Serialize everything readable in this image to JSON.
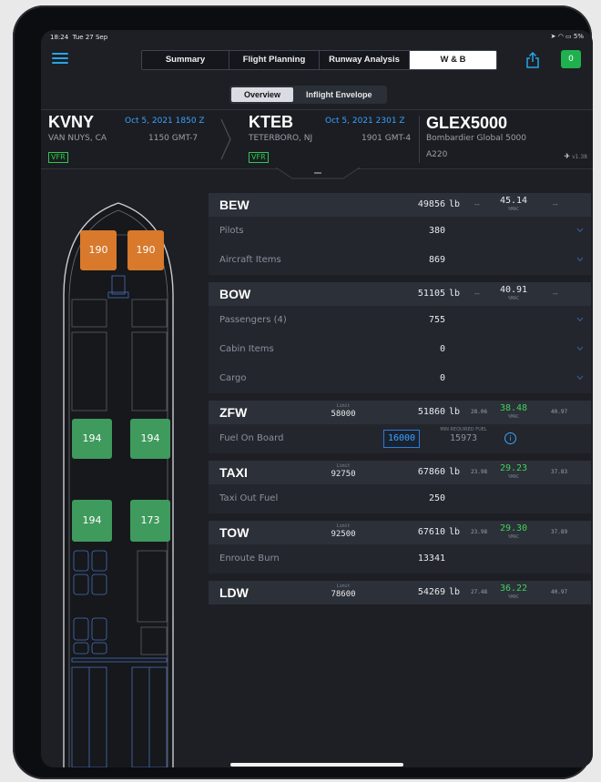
{
  "status": {
    "time": "18:24",
    "date": "Tue 27 Sep",
    "battery": "5%"
  },
  "nav": {
    "tabs": [
      {
        "label": "Summary"
      },
      {
        "label": "Flight Planning"
      },
      {
        "label": "Runway Analysis"
      },
      {
        "label": "W & B",
        "active": true
      }
    ],
    "badge": "0"
  },
  "subtabs": [
    {
      "label": "Overview",
      "active": true
    },
    {
      "label": "Inflight Envelope"
    }
  ],
  "route": {
    "from": {
      "code": "KVNY",
      "datetime": "Oct 5, 2021 1850 Z",
      "city": "VAN NUYS, CA",
      "local": "1150 GMT-7",
      "rules": "VFR"
    },
    "to": {
      "code": "KTEB",
      "datetime": "Oct 5, 2021 2301 Z",
      "city": "TETERBORO, NJ",
      "local": "1901 GMT-4",
      "rules": "VFR"
    },
    "aircraft": {
      "type": "GLEX5000",
      "name": "Bombardier Global 5000",
      "reg": "A220",
      "version": "v1.38"
    }
  },
  "seats": {
    "pilots": [
      "190",
      "190"
    ],
    "row1": [
      "194",
      "194"
    ],
    "row2": [
      "194",
      "173"
    ]
  },
  "wb": {
    "bew": {
      "label": "BEW",
      "value": "49856",
      "unit": "lb",
      "dash1": "--",
      "mac": "45.14",
      "mac_unit": "%MAC",
      "dash2": "--"
    },
    "pilots": {
      "label": "Pilots",
      "value": "380"
    },
    "aircraft_items": {
      "label": "Aircraft Items",
      "value": "869"
    },
    "bow": {
      "label": "BOW",
      "value": "51105",
      "unit": "lb",
      "dash1": "--",
      "mac": "40.91",
      "mac_unit": "%MAC",
      "dash2": "--"
    },
    "passengers": {
      "label": "Passengers (4)",
      "value": "755"
    },
    "cabin_items": {
      "label": "Cabin Items",
      "value": "0"
    },
    "cargo": {
      "label": "Cargo",
      "value": "0"
    },
    "zfw": {
      "label": "ZFW",
      "limit_cap": "Limit",
      "limit": "58000",
      "value": "51860",
      "unit": "lb",
      "fwd": "28.06",
      "mac": "38.48",
      "mac_unit": "%MAC",
      "aft": "40.97"
    },
    "fuel": {
      "label": "Fuel On Board",
      "value": "16000",
      "min_cap": "MIN REQUIRED FUEL",
      "min": "15973",
      "info": "i"
    },
    "taxi": {
      "label": "TAXI",
      "limit_cap": "Limit",
      "limit": "92750",
      "value": "67860",
      "unit": "lb",
      "fwd": "23.98",
      "mac": "29.23",
      "mac_unit": "%MAC",
      "aft": "37.83"
    },
    "taxi_fuel": {
      "label": "Taxi Out Fuel",
      "value": "250"
    },
    "tow": {
      "label": "TOW",
      "limit_cap": "Limit",
      "limit": "92500",
      "value": "67610",
      "unit": "lb",
      "fwd": "23.98",
      "mac": "29.30",
      "mac_unit": "%MAC",
      "aft": "37.89"
    },
    "enroute": {
      "label": "Enroute Burn",
      "value": "13341"
    },
    "ldw": {
      "label": "LDW",
      "limit_cap": "Limit",
      "limit": "78600",
      "value": "54269",
      "unit": "lb",
      "fwd": "27.48",
      "mac": "36.22",
      "mac_unit": "%MAC",
      "aft": "40.97"
    }
  },
  "colors": {
    "accent": "#3aa2ff",
    "green": "#3fd25b",
    "seat_crew": "#d8792c",
    "seat_pax": "#3f9a5d"
  }
}
